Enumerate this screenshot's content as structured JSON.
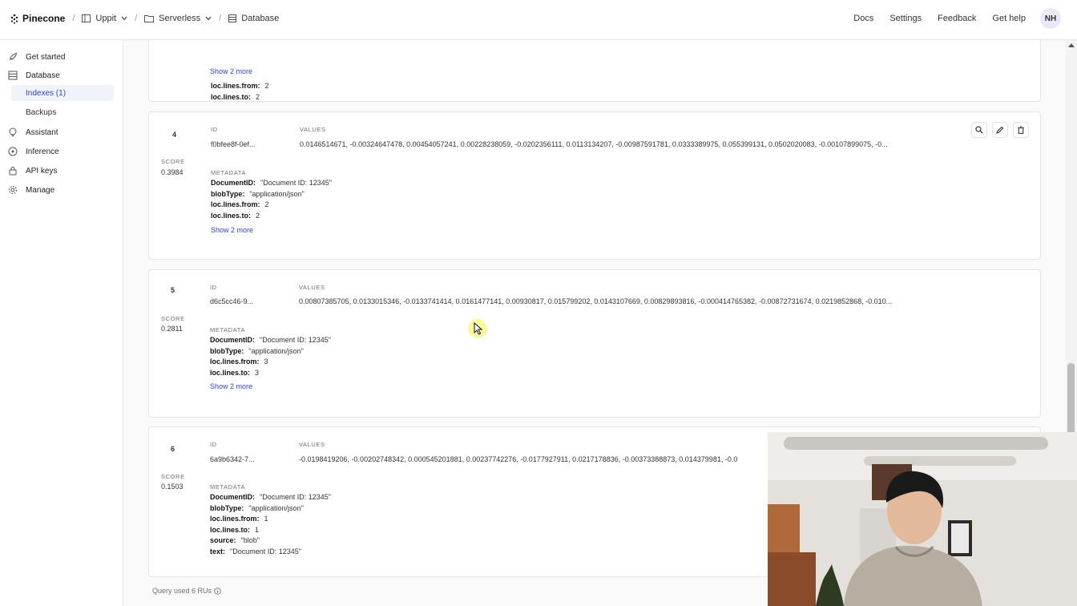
{
  "topbar": {
    "brand": "Pinecone",
    "breadcrumb": [
      {
        "label": "Uppit",
        "icon": "org-icon"
      },
      {
        "label": "Serverless",
        "icon": "folder-icon"
      },
      {
        "label": "Database",
        "icon": "database-icon"
      }
    ],
    "nav": [
      "Docs",
      "Settings",
      "Feedback",
      "Get help"
    ],
    "avatar_initials": "NH"
  },
  "sidebar": {
    "items": [
      {
        "label": "Get started",
        "icon": "rocket-icon"
      },
      {
        "label": "Database",
        "icon": "database-icon"
      },
      {
        "label": "Indexes (1)",
        "sub": true,
        "active": true
      },
      {
        "label": "Backups",
        "sub": true
      },
      {
        "label": "Assistant",
        "icon": "assistant-icon"
      },
      {
        "label": "Inference",
        "icon": "inference-icon"
      },
      {
        "label": "API keys",
        "icon": "lock-icon"
      },
      {
        "label": "Manage",
        "icon": "gear-icon"
      }
    ]
  },
  "partial_card": {
    "metadata": [
      {
        "key": "loc.lines.from:",
        "value": "2"
      },
      {
        "key": "loc.lines.to:",
        "value": "2"
      }
    ],
    "show_more": "Show 2 more"
  },
  "labels": {
    "id": "ID",
    "values": "VALUES",
    "score": "SCORE",
    "metadata": "METADATA"
  },
  "results": [
    {
      "rank": "4",
      "score": "0.3984",
      "id": "f0bfee8f-0ef...",
      "values": "0.0146514671, -0.00324647478, 0.00454057241, 0.00228238059, -0.0202356111, 0.0113134207, -0.00987591781, 0.0333389975, 0.055399131, 0.0502020083, -0.00107899075, -0...",
      "metadata": [
        {
          "key": "DocumentID:",
          "value": "\"Document ID: 12345\""
        },
        {
          "key": "blobType:",
          "value": "\"application/json\""
        },
        {
          "key": "loc.lines.from:",
          "value": "2"
        },
        {
          "key": "loc.lines.to:",
          "value": "2"
        }
      ],
      "show_more": "Show 2 more"
    },
    {
      "rank": "5",
      "score": "0.2811",
      "id": "d6c5cc46-9...",
      "values": "0.00807385705, 0.0133015346, -0.0133741414, 0.0161477141, 0.00930817, 0.015799202, 0.0143107669, 0.00829893816, -0.000414765382, -0.00872731674, 0.0219852868, -0.010...",
      "metadata": [
        {
          "key": "DocumentID:",
          "value": "\"Document ID: 12345\""
        },
        {
          "key": "blobType:",
          "value": "\"application/json\""
        },
        {
          "key": "loc.lines.from:",
          "value": "3"
        },
        {
          "key": "loc.lines.to:",
          "value": "3"
        }
      ],
      "show_more": "Show 2 more"
    },
    {
      "rank": "6",
      "score": "0.1503",
      "id": "6a9b6342-7...",
      "values": "-0.0198419206, -0.00202748342, 0.000545201881, 0.00237742276, -0.0177927911, 0.0217178836, -0.00373388873, 0.014379981, -0.0",
      "metadata": [
        {
          "key": "DocumentID:",
          "value": "\"Document ID: 12345\""
        },
        {
          "key": "blobType:",
          "value": "\"application/json\""
        },
        {
          "key": "loc.lines.from:",
          "value": "1"
        },
        {
          "key": "loc.lines.to:",
          "value": "1"
        },
        {
          "key": "source:",
          "value": "\"blob\""
        },
        {
          "key": "text:",
          "value": "\"Document ID: 12345\""
        }
      ]
    }
  ],
  "footer": {
    "note": "Query used 6 RUs"
  }
}
